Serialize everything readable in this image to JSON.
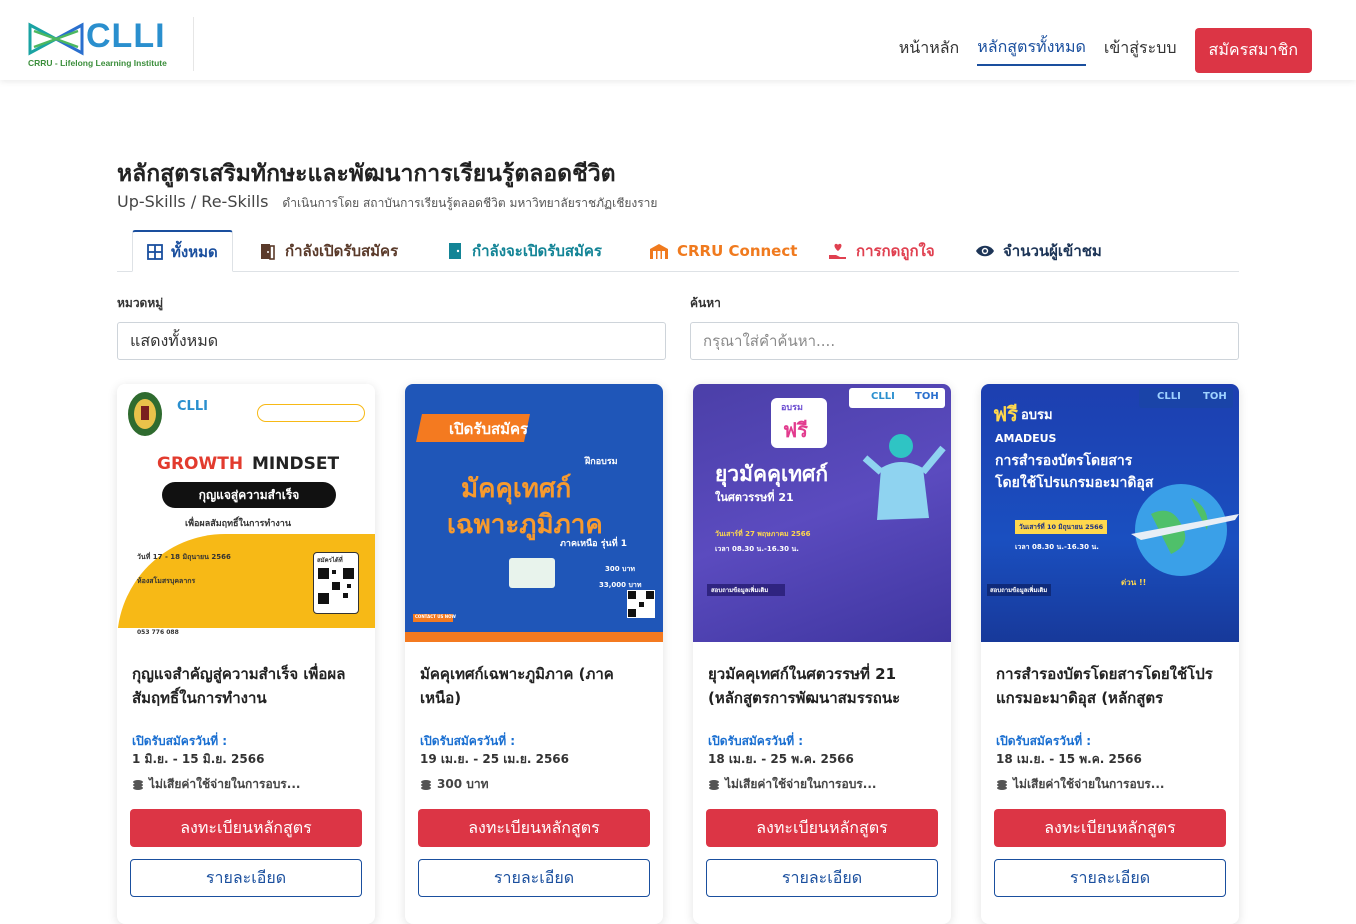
{
  "header": {
    "logo_name": "CLLI",
    "logo_sub": "CRRU - Lifelong Learning Institute",
    "nav": {
      "home": "หน้าหลัก",
      "all_courses": "หลักสูตรทั้งหมด",
      "login": "เข้าสู่ระบบ",
      "signup": "สมัครสมาชิก"
    }
  },
  "page": {
    "title": "หลักสูตรเสริมทักษะและพัฒนาการเรียนรู้ตลอดชีวิต",
    "skills": "Up-Skills / Re-Skills",
    "operated_by": "ดำเนินการโดย สถาบันการเรียนรู้ตลอดชีวิต มหาวิทยาลัยราชภัฏเชียงราย"
  },
  "tabs": [
    {
      "label": "ทั้งหมด",
      "icon": "grid-icon",
      "color": "#1a4f9e"
    },
    {
      "label": "กำลังเปิดรับสมัคร",
      "icon": "door-open-icon",
      "color": "#5a3a2a"
    },
    {
      "label": "กำลังจะเปิดรับสมัคร",
      "icon": "door-closed-icon",
      "color": "#138496"
    },
    {
      "label": "CRRU Connect",
      "icon": "building-icon",
      "color": "#f07a1e"
    },
    {
      "label": "การกดถูกใจ",
      "icon": "heart-hand-icon",
      "color": "#e04050"
    },
    {
      "label": "จำนวนผู้เข้าชม",
      "icon": "eye-icon",
      "color": "#1d3557"
    }
  ],
  "filters": {
    "category_label": "หมวดหมู่",
    "category_value": "แสดงทั้งหมด",
    "search_label": "ค้นหา",
    "search_placeholder": "กรุณาใส่คำค้นหา...."
  },
  "cards": [
    {
      "title": "กุญแจสำคัญสู่ความสำเร็จ เพื่อผลสัมฤทธิ์ในการทำงาน",
      "open_label": "เปิดรับสมัครวันที่ :",
      "open_date": "1 มิ.ย. - 15 มิ.ย. 2566",
      "price": "ไม่เสียค่าใช้จ่ายในการอบร...",
      "register": "ลงทะเบียนหลักสูตร",
      "detail": "รายละเอียด",
      "poster": {
        "brand": "CLLI",
        "headline_1": "GROWTH",
        "headline_2": "MINDSET",
        "banner": "กุญแจสู่ความสำเร็จ",
        "tagline": "เพื่อผลสัมฤทธิ์ในการทำงาน",
        "date": "วันที่ 17 - 18 มิถุนายน 2566",
        "place": "ห้องสโมสรบุคลากร",
        "apply": "สมัครได้ที่",
        "footer": "053 776 088"
      }
    },
    {
      "title": "มัคคุเทศก์เฉพาะภูมิภาค (ภาคเหนือ)",
      "open_label": "เปิดรับสมัครวันที่ :",
      "open_date": "19 เม.ย. - 25 เม.ย. 2566",
      "price": "300 บาท",
      "register": "ลงทะเบียนหลักสูตร",
      "detail": "รายละเอียด",
      "poster": {
        "ribbon": "เปิดรับสมัคร",
        "train": "ฝึกอบรม",
        "line1": "มัคคุเทศก์",
        "line2": "เฉพาะภูมิภาค",
        "region": "ภาคเหนือ รุ่นที่ 1",
        "fee1": "300 บาท",
        "fee2": "33,000 บาท",
        "footer": "CONTACT US NOW"
      }
    },
    {
      "title": "ยุวมัคคุเทศก์ในศตวรรษที่ 21 (หลักสูตรการพัฒนาสมรรถนะ",
      "open_label": "เปิดรับสมัครวันที่ :",
      "open_date": "18 เม.ย. - 25 พ.ค. 2566",
      "price": "ไม่เสียค่าใช้จ่ายในการอบร...",
      "register": "ลงทะเบียนหลักสูตร",
      "detail": "รายละเอียด",
      "poster": {
        "badge_top": "อบรม",
        "badge_main": "ฟรี",
        "brand": "CLLI",
        "brand2": "TOH",
        "line1": "ยุวมัคคุเทศก์",
        "line2": "ในศตวรรษที่ 21",
        "date": "วันเสาร์ที่ 27 พฤษภาคม 2566",
        "time": "เวลา 08.30 น.-16.30 น.",
        "info": "สอบถามข้อมูลเพิ่มเติม"
      }
    },
    {
      "title": "การสำรองบัตรโดยสารโดยใช้โปรแกรมอะมาดิอุส (หลักสูตร",
      "open_label": "เปิดรับสมัครวันที่ :",
      "open_date": "18 เม.ย. - 15 พ.ค. 2566",
      "price": "ไม่เสียค่าใช้จ่ายในการอบร...",
      "register": "ลงทะเบียนหลักสูตร",
      "detail": "รายละเอียด",
      "poster": {
        "free": "ฟรี",
        "train": "อบรม",
        "brand": "CLLI",
        "brand2": "TOH",
        "amadeus": "AMADEUS",
        "line1": "การสำรองบัตรโดยสาร",
        "line2": "โดยใช้โปรแกรมอะมาดิอุส",
        "date": "วันเสาร์ที่ 10 มิถุนายน 2566",
        "time": "เวลา 08.30 น.-16.30 น.",
        "hurry": "ด่วน !!",
        "info": "สอบถามข้อมูลเพิ่มเติม"
      }
    }
  ],
  "colors": {
    "primary": "#1a4f9e",
    "danger": "#dc3545",
    "link_blue": "#1a6fd1"
  }
}
